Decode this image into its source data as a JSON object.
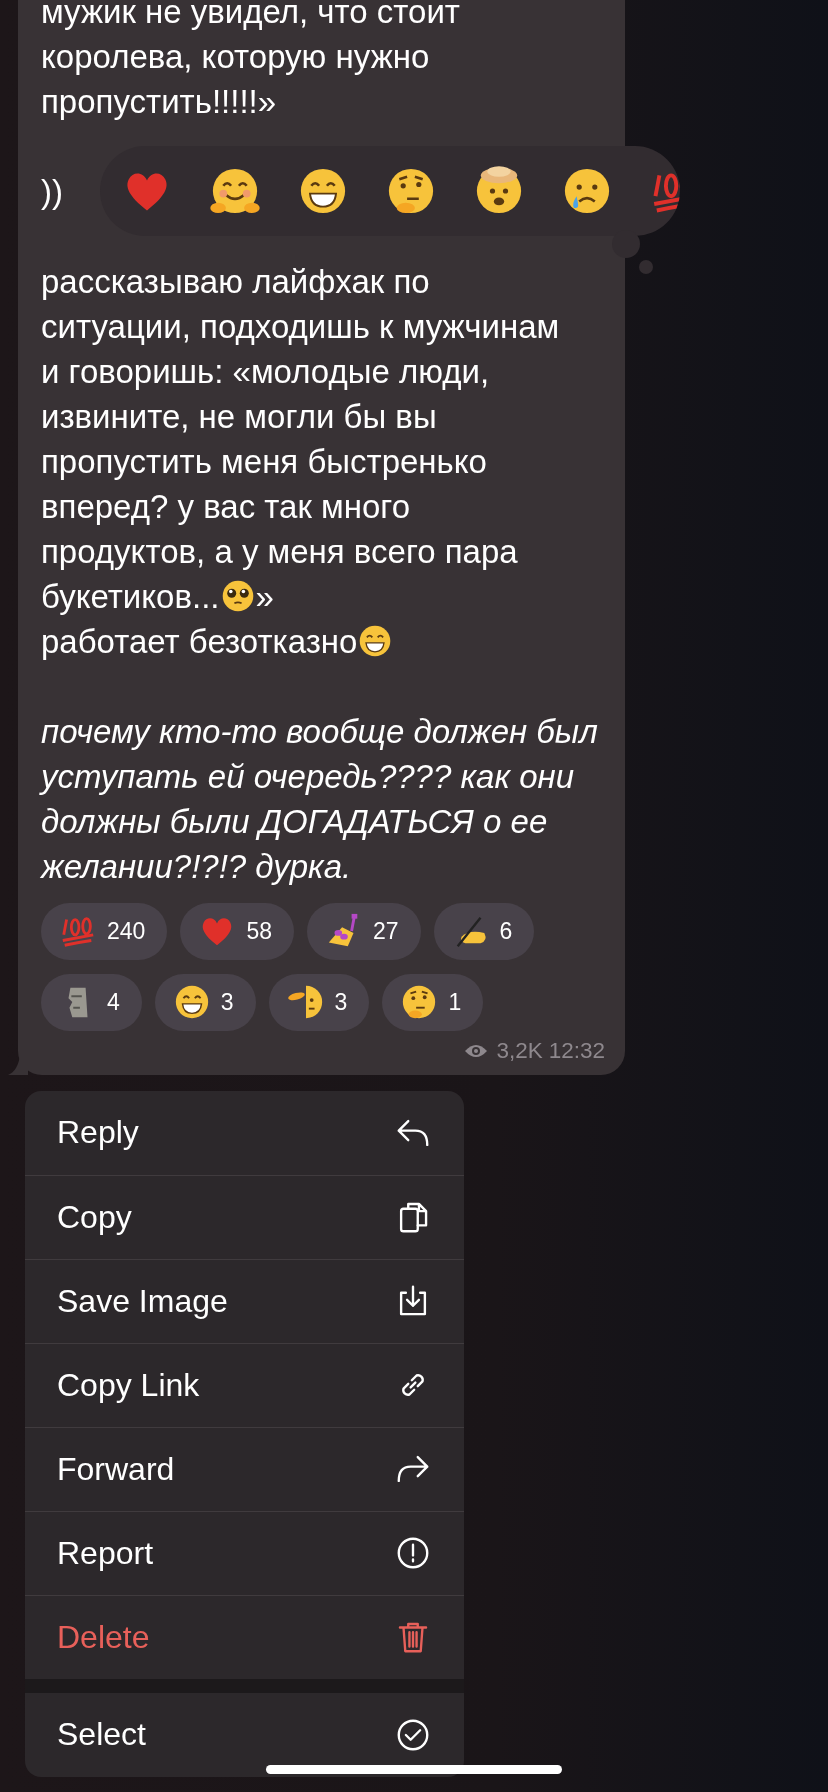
{
  "message": {
    "blocks": [
      {
        "kind": "plain",
        "lines": [
          {
            "text": "мужик не увидел, что стоит"
          },
          {
            "text": "королева, которую нужно"
          },
          {
            "text": "пропустить!!!!!»"
          }
        ]
      },
      {
        "kind": "plain",
        "lines": [
          {
            "text": "))"
          }
        ]
      },
      {
        "kind": "plain",
        "lines": [
          {
            "text": "рассказываю лайфхак по"
          },
          {
            "text": "ситуации, подходишь к мужчинам"
          },
          {
            "text": "и говоришь: «молодые люди,"
          },
          {
            "text": "извините, не могли бы вы"
          },
          {
            "text": "пропустить меня быстренько"
          },
          {
            "text": "вперед? у вас так много"
          },
          {
            "text": "продуктов, а у меня всего пара"
          },
          {
            "text": "букетиков...",
            "kind": "pleading",
            "tail": "»"
          },
          {
            "text": "работает безотказно",
            "kind": "grin"
          }
        ]
      },
      {
        "kind": "italic",
        "lines": [
          {
            "text": "почему кто-то вообще должен был"
          },
          {
            "text": "уступать ей очередь???? как они"
          },
          {
            "text": "должны были ДОГАДАТЬСЯ о ее"
          },
          {
            "text": "желании?!?!? дурка."
          }
        ]
      }
    ],
    "reactions": [
      {
        "kind": "hundred",
        "count": "240",
        "selected": false
      },
      {
        "kind": "heart",
        "count": "58",
        "selected": false
      },
      {
        "kind": "nail",
        "count": "27",
        "selected": false
      },
      {
        "kind": "writing",
        "count": "6",
        "selected": false
      },
      {
        "kind": "moai",
        "count": "4",
        "selected": false
      },
      {
        "kind": "grin",
        "count": "3",
        "selected": false
      },
      {
        "kind": "salute",
        "count": "3",
        "selected": false
      },
      {
        "kind": "think",
        "count": "1",
        "selected": false
      }
    ],
    "views": "3,2K",
    "time": "12:32"
  },
  "context_menu": {
    "sections": [
      [
        {
          "label": "Reply",
          "kind": "reply"
        },
        {
          "label": "Copy",
          "kind": "copy"
        },
        {
          "label": "Save Image",
          "kind": "save"
        },
        {
          "label": "Copy Link",
          "kind": "link"
        },
        {
          "label": "Forward",
          "kind": "forward"
        },
        {
          "label": "Report",
          "kind": "report"
        },
        {
          "label": "Delete",
          "kind": "delete"
        }
      ],
      [
        {
          "label": "Select",
          "kind": "select"
        }
      ]
    ]
  }
}
